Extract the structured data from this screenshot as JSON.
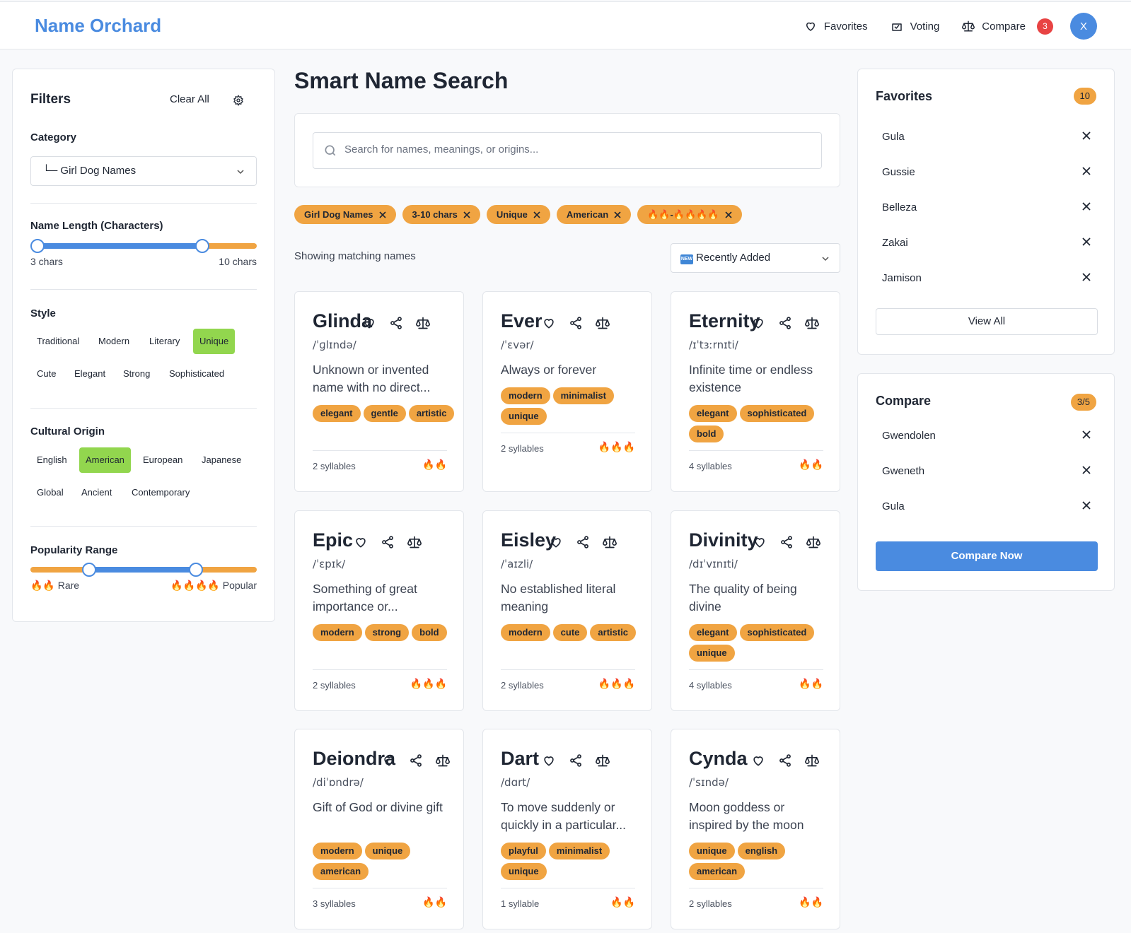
{
  "header": {
    "logo": "Name Orchard",
    "nav": {
      "favorites": "Favorites",
      "voting": "Voting",
      "compare": "Compare",
      "compare_count": "3"
    },
    "avatar_initial": "X"
  },
  "filters": {
    "title": "Filters",
    "clear_all": "Clear All",
    "category": {
      "label": "Category",
      "value": "└─ Girl Dog Names"
    },
    "name_length": {
      "label": "Name Length (Characters)",
      "min_label": "3 chars",
      "max_label": "10 chars",
      "min_fraction": 0.03,
      "max_fraction": 0.76
    },
    "style": {
      "label": "Style",
      "options": [
        "Traditional",
        "Modern",
        "Literary",
        "Unique",
        "Cute",
        "Elegant",
        "Strong",
        "Sophisticated"
      ],
      "selected": "Unique"
    },
    "origin": {
      "label": "Cultural Origin",
      "options": [
        "English",
        "American",
        "European",
        "Japanese",
        "Global",
        "Ancient",
        "Contemporary"
      ],
      "selected": "American"
    },
    "popularity": {
      "label": "Popularity Range",
      "min_label": "🔥🔥 Rare",
      "max_label": "🔥🔥🔥🔥 Popular",
      "min_fraction": 0.26,
      "max_fraction": 0.73
    }
  },
  "main": {
    "title": "Smart Name Search",
    "search_placeholder": "Search for names, meanings, or origins...",
    "active_filters": [
      "Girl Dog Names",
      "3-10 chars",
      "Unique",
      "American",
      "🔥🔥-🔥🔥🔥🔥"
    ],
    "showing": "Showing matching names",
    "sort": {
      "icon_text": "NEW",
      "value": "Recently Added"
    },
    "cards": [
      {
        "name": "Glinda",
        "pron": "/ˈɡlɪndə/",
        "meaning": "Unknown or invented name with no direct...",
        "tags": [
          "elegant",
          "gentle",
          "artistic"
        ],
        "syllables": "2 syllables",
        "fire": "🔥🔥"
      },
      {
        "name": "Ever",
        "pron": "/ˈɛvər/",
        "meaning": "Always or forever",
        "tags": [
          "modern",
          "minimalist",
          "unique"
        ],
        "syllables": "2 syllables",
        "fire": "🔥🔥🔥"
      },
      {
        "name": "Eternity",
        "pron": "/ɪˈtɜːrnɪti/",
        "meaning": "Infinite time or endless existence",
        "tags": [
          "elegant",
          "sophisticated",
          "bold"
        ],
        "syllables": "4 syllables",
        "fire": "🔥🔥"
      },
      {
        "name": "Epic",
        "pron": "/ˈɛpɪk/",
        "meaning": "Something of great importance or...",
        "tags": [
          "modern",
          "strong",
          "bold"
        ],
        "syllables": "2 syllables",
        "fire": "🔥🔥🔥"
      },
      {
        "name": "Eisley",
        "pron": "/ˈaɪzli/",
        "meaning": "No established literal meaning",
        "tags": [
          "modern",
          "cute",
          "artistic"
        ],
        "syllables": "2 syllables",
        "fire": "🔥🔥🔥"
      },
      {
        "name": "Divinity",
        "pron": "/dɪˈvɪnɪti/",
        "meaning": "The quality of being divine",
        "tags": [
          "elegant",
          "sophisticated",
          "unique"
        ],
        "syllables": "4 syllables",
        "fire": "🔥🔥"
      },
      {
        "name": "Deiondra",
        "pron": "/diˈɒndrə/",
        "meaning": "Gift of God or divine gift",
        "tags": [
          "modern",
          "unique",
          "american"
        ],
        "syllables": "3 syllables",
        "fire": "🔥🔥"
      },
      {
        "name": "Dart",
        "pron": "/dɑrt/",
        "meaning": "To move suddenly or quickly in a particular...",
        "tags": [
          "playful",
          "minimalist",
          "unique"
        ],
        "syllables": "1 syllable",
        "fire": "🔥🔥"
      },
      {
        "name": "Cynda",
        "pron": "/ˈsɪndə/",
        "meaning": "Moon goddess or inspired by the moon",
        "tags": [
          "unique",
          "english",
          "american"
        ],
        "syllables": "2 syllables",
        "fire": "🔥🔥"
      }
    ]
  },
  "favorites": {
    "title": "Favorites",
    "count": "10",
    "items": [
      "Gula",
      "Gussie",
      "Belleza",
      "Zakai",
      "Jamison"
    ],
    "view_all": "View All"
  },
  "compare": {
    "title": "Compare",
    "count": "3/5",
    "items": [
      "Gwendolen",
      "Gweneth",
      "Gula"
    ],
    "compare_now": "Compare Now"
  },
  "colors": {
    "accent_blue": "#4a8be0",
    "tag_orange": "#f0a442",
    "selected_green": "#92d64e",
    "badge_red": "#e84343"
  }
}
